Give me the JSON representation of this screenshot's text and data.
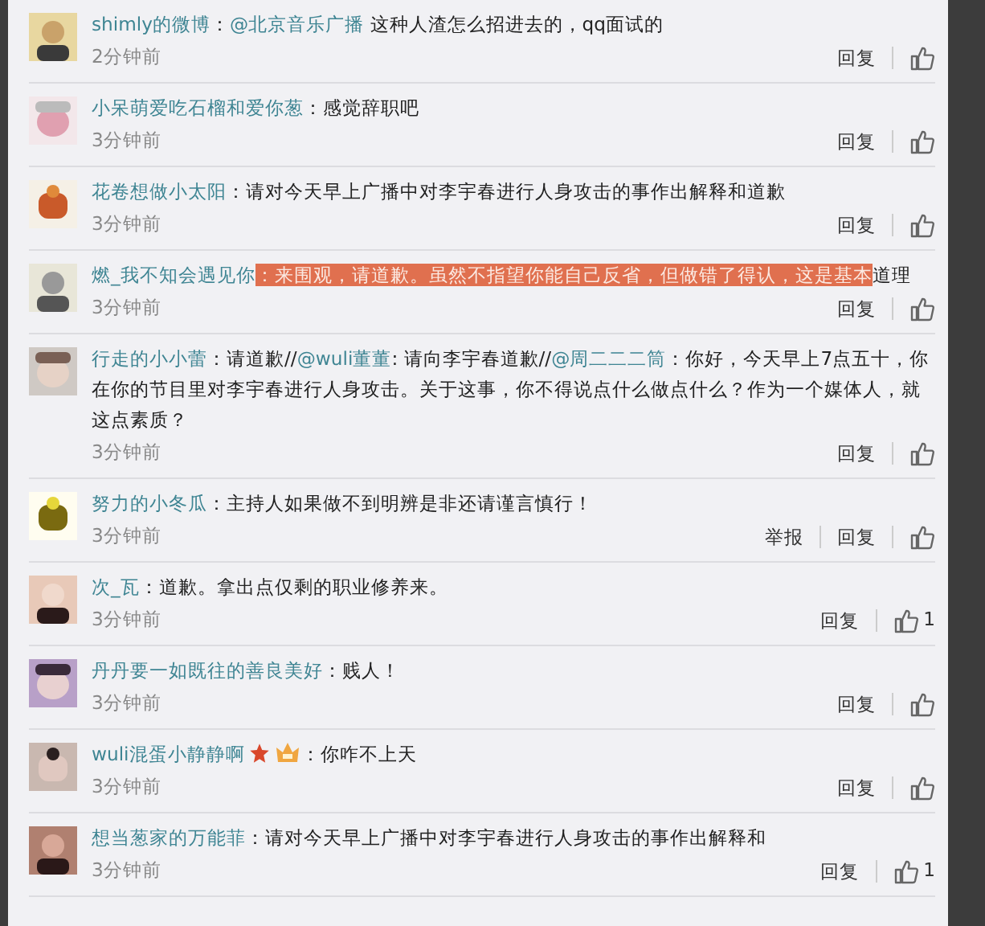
{
  "comments": [
    {
      "user": "shimly的微博",
      "segments": [
        {
          "text": "："
        },
        {
          "text": "@北京音乐广播",
          "link": true
        },
        {
          "text": " 这种人渣怎么招进去的，qq面试的"
        }
      ],
      "time": "2分钟前",
      "actions": [
        "回复"
      ],
      "avatar": {
        "kind": "picture"
      }
    },
    {
      "user": "小呆萌爱吃石榴和爱你葱",
      "segments": [
        {
          "text": "：感觉辞职吧"
        }
      ],
      "time": "3分钟前",
      "actions": [
        "回复"
      ],
      "avatar": {
        "kind": "picture"
      }
    },
    {
      "user": "花卷想做小太阳",
      "segments": [
        {
          "text": "：请对今天早上广播中对李宇春进行人身攻击的事作出解释和道歉"
        }
      ],
      "time": "3分钟前",
      "actions": [
        "回复"
      ],
      "avatar": {
        "kind": "picture"
      }
    },
    {
      "user": "燃_我不知会遇见你",
      "segments": [
        {
          "text": "：来围观，请道歉。虽然不指望你能自己反省，但做错了得认，这是基本",
          "highlighted": true
        },
        {
          "text": "道理",
          "highlighted": false
        }
      ],
      "time": "3分钟前",
      "actions": [
        "回复"
      ],
      "avatar": {
        "kind": "picture"
      }
    },
    {
      "user": "行走的小小蕾",
      "segments": [
        {
          "text": "：请道歉//"
        },
        {
          "text": "@wuli董董",
          "link": true
        },
        {
          "text": ": 请向李宇春道歉//"
        },
        {
          "text": "@周二二二筒",
          "link": true
        },
        {
          "text": "：你好，今天早上7点五十，你在你的节目里对李宇春进行人身攻击。关于这事，你不得说点什么做点什么？作为一个媒体人，就这点素质？"
        }
      ],
      "time": "3分钟前",
      "actions": [
        "回复"
      ],
      "avatar": {
        "kind": "picture"
      }
    },
    {
      "user": "努力的小冬瓜",
      "segments": [
        {
          "text": "：主持人如果做不到明辨是非还请谨言慎行！"
        }
      ],
      "time": "3分钟前",
      "actions": [
        "举报",
        "回复"
      ],
      "avatar": {
        "kind": "picture"
      }
    },
    {
      "user": "次_瓦",
      "segments": [
        {
          "text": "：道歉。拿出点仅剩的职业修养来。"
        }
      ],
      "time": "3分钟前",
      "actions": [
        "回复"
      ],
      "likes": "1",
      "avatar": {
        "kind": "picture"
      }
    },
    {
      "user": "丹丹要一如既往的善良美好",
      "segments": [
        {
          "text": "：贱人！"
        }
      ],
      "time": "3分钟前",
      "actions": [
        "回复"
      ],
      "avatar": {
        "kind": "picture"
      }
    },
    {
      "user": "wuli混蛋小静静啊",
      "badges": [
        {
          "kind": "star"
        },
        {
          "kind": "crown"
        }
      ],
      "segments": [
        {
          "text": "：你咋不上天"
        }
      ],
      "time": "3分钟前",
      "actions": [
        "回复"
      ],
      "avatar": {
        "kind": "picture"
      }
    },
    {
      "user": "想当葱家的万能菲",
      "segments": [
        {
          "text": "：请对今天早上广播中对李宇春进行人身攻击的事作出解释和"
        }
      ],
      "time": "3分钟前",
      "actions": [
        "回复"
      ],
      "likes": "1",
      "avatar": {
        "kind": "picture"
      }
    }
  ]
}
